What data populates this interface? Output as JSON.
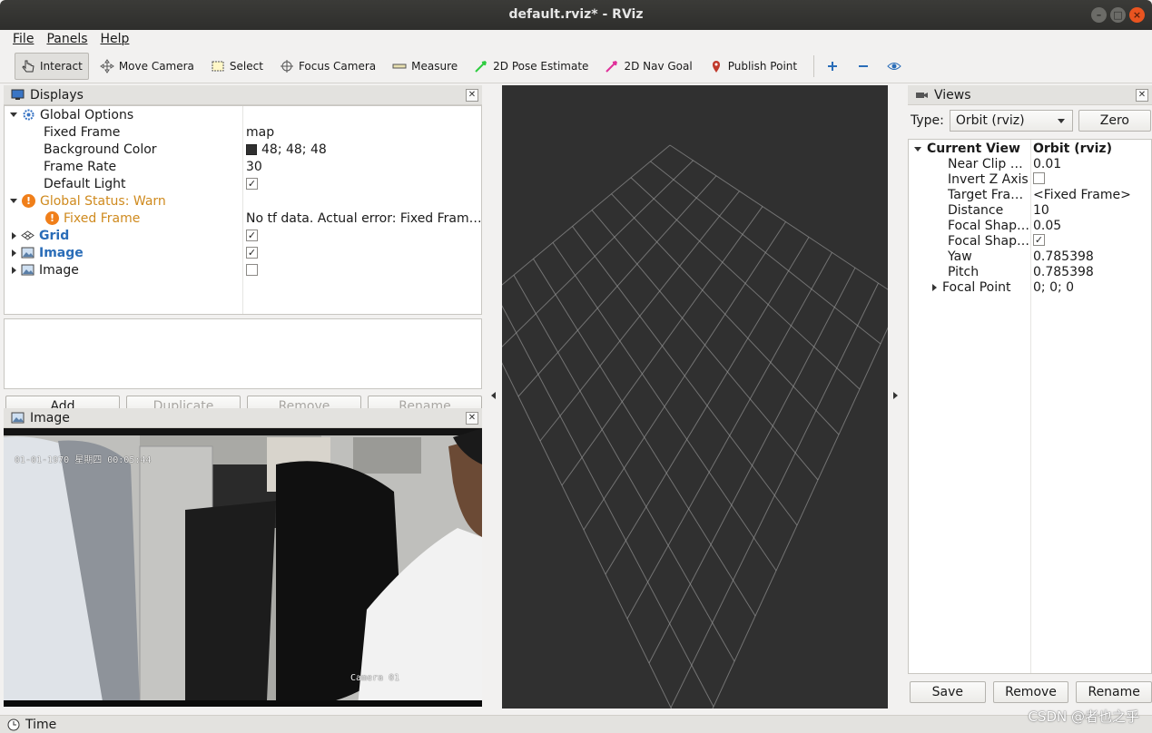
{
  "window": {
    "title": "default.rviz* - RViz"
  },
  "menu": [
    "File",
    "Panels",
    "Help"
  ],
  "toolbar": [
    {
      "label": "Interact",
      "icon": "hand-pointer-icon",
      "active": true
    },
    {
      "label": "Move Camera",
      "icon": "move-arrows-icon"
    },
    {
      "label": "Select",
      "icon": "select-rect-icon"
    },
    {
      "label": "Focus Camera",
      "icon": "crosshair-icon"
    },
    {
      "label": "Measure",
      "icon": "ruler-icon"
    },
    {
      "label": "2D Pose Estimate",
      "icon": "green-arrow-icon",
      "color": "#2ecc40"
    },
    {
      "label": "2D Nav Goal",
      "icon": "magenta-arrow-icon",
      "color": "#e0309a"
    },
    {
      "label": "Publish Point",
      "icon": "map-pin-icon",
      "color": "#c0392b"
    }
  ],
  "displays": {
    "title": "Displays",
    "rows": [
      {
        "label": "Global Options",
        "value": ""
      },
      {
        "label": "Fixed Frame",
        "value": "map"
      },
      {
        "label": "Background Color",
        "value": "48; 48; 48"
      },
      {
        "label": "Frame Rate",
        "value": "30"
      },
      {
        "label": "Default Light",
        "value": "✓"
      },
      {
        "label": "Global Status: Warn",
        "value": ""
      },
      {
        "label": "Fixed Frame",
        "value": "No tf data.  Actual error: Fixed Fram…"
      },
      {
        "label": "Grid",
        "value": "✓"
      },
      {
        "label": "Image",
        "value": "✓"
      },
      {
        "label": "Image",
        "value": ""
      }
    ],
    "buttons": {
      "add": "Add",
      "duplicate": "Duplicate",
      "remove": "Remove",
      "rename": "Rename"
    }
  },
  "image_panel": {
    "title": "Image",
    "osd_datetime": "01-01-1970 星期四 00:05:44",
    "osd_camera": "Camera 01"
  },
  "views": {
    "title": "Views",
    "type_label": "Type:",
    "type_value": "Orbit (rviz)",
    "zero": "Zero",
    "rows": [
      {
        "label": "Current View",
        "value": "Orbit (rviz)"
      },
      {
        "label": "Near Clip …",
        "value": "0.01"
      },
      {
        "label": "Invert Z Axis",
        "value": ""
      },
      {
        "label": "Target Fra…",
        "value": "<Fixed Frame>"
      },
      {
        "label": "Distance",
        "value": "10"
      },
      {
        "label": "Focal Shap…",
        "value": "0.05"
      },
      {
        "label": "Focal Shap…",
        "value": "✓"
      },
      {
        "label": "Yaw",
        "value": "0.785398"
      },
      {
        "label": "Pitch",
        "value": "0.785398"
      },
      {
        "label": "Focal Point",
        "value": "0; 0; 0"
      }
    ],
    "buttons": {
      "save": "Save",
      "remove": "Remove",
      "rename": "Rename"
    }
  },
  "time_panel": {
    "title": "Time"
  },
  "watermark": "CSDN @者也之乎",
  "colors": {
    "background": "#303030",
    "grid": "#a0a0a0",
    "warn": "#f07f1a"
  }
}
